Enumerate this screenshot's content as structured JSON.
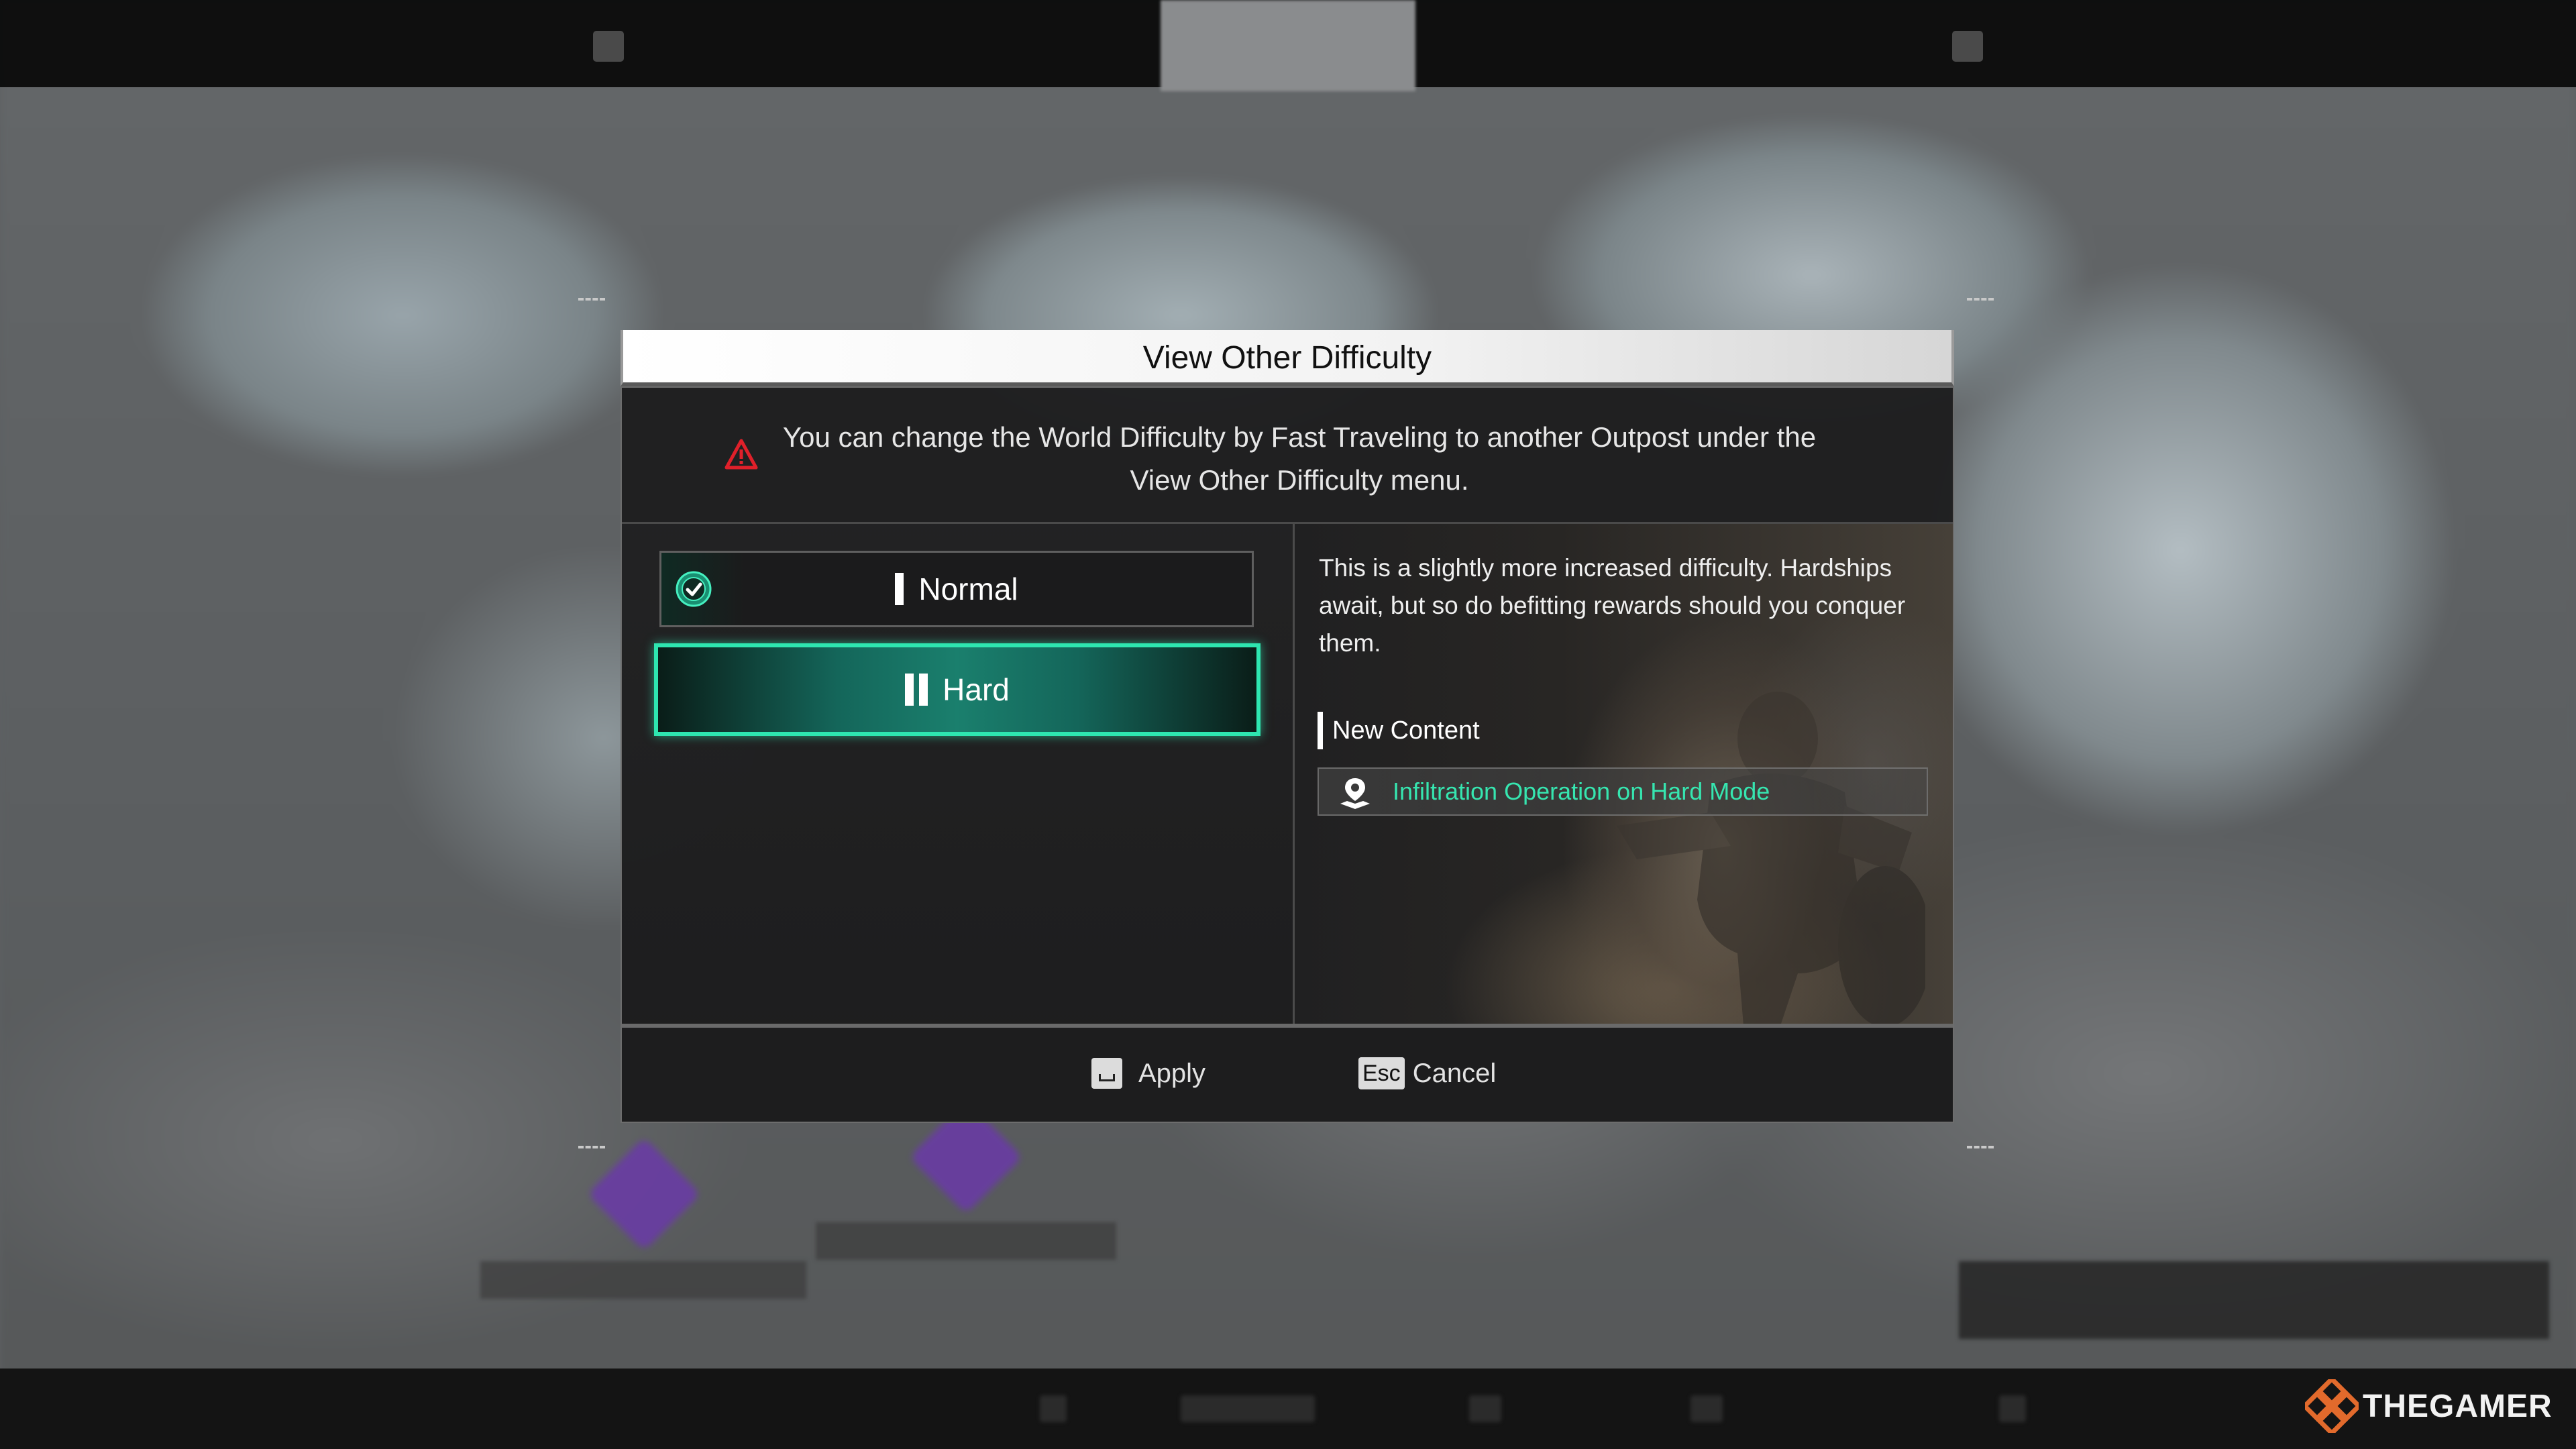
{
  "dialog": {
    "title": "View Other Difficulty",
    "warning_text": "You can change the World Difficulty by Fast Traveling to another Outpost under the View Other Difficulty menu.",
    "options": [
      {
        "label": "Normal",
        "tier": 1,
        "current": true,
        "selected": false
      },
      {
        "label": "Hard",
        "tier": 2,
        "current": false,
        "selected": true
      }
    ],
    "detail": {
      "description": "This is a slightly more increased difficulty. Hardships await, but so do befitting rewards should you conquer them.",
      "new_content_header": "New Content",
      "new_content_items": [
        {
          "label": "Infiltration Operation on Hard Mode",
          "icon": "map-pin-icon"
        }
      ]
    },
    "footer": {
      "apply_label": "Apply",
      "cancel_key": "Esc",
      "cancel_label": "Cancel"
    }
  },
  "watermark": {
    "text": "THEGAMER"
  },
  "colors": {
    "accent": "#2ee6b0",
    "item_text": "#36e6b0",
    "warning": "#e0202a",
    "panel_bg": "#1e1e1f"
  }
}
